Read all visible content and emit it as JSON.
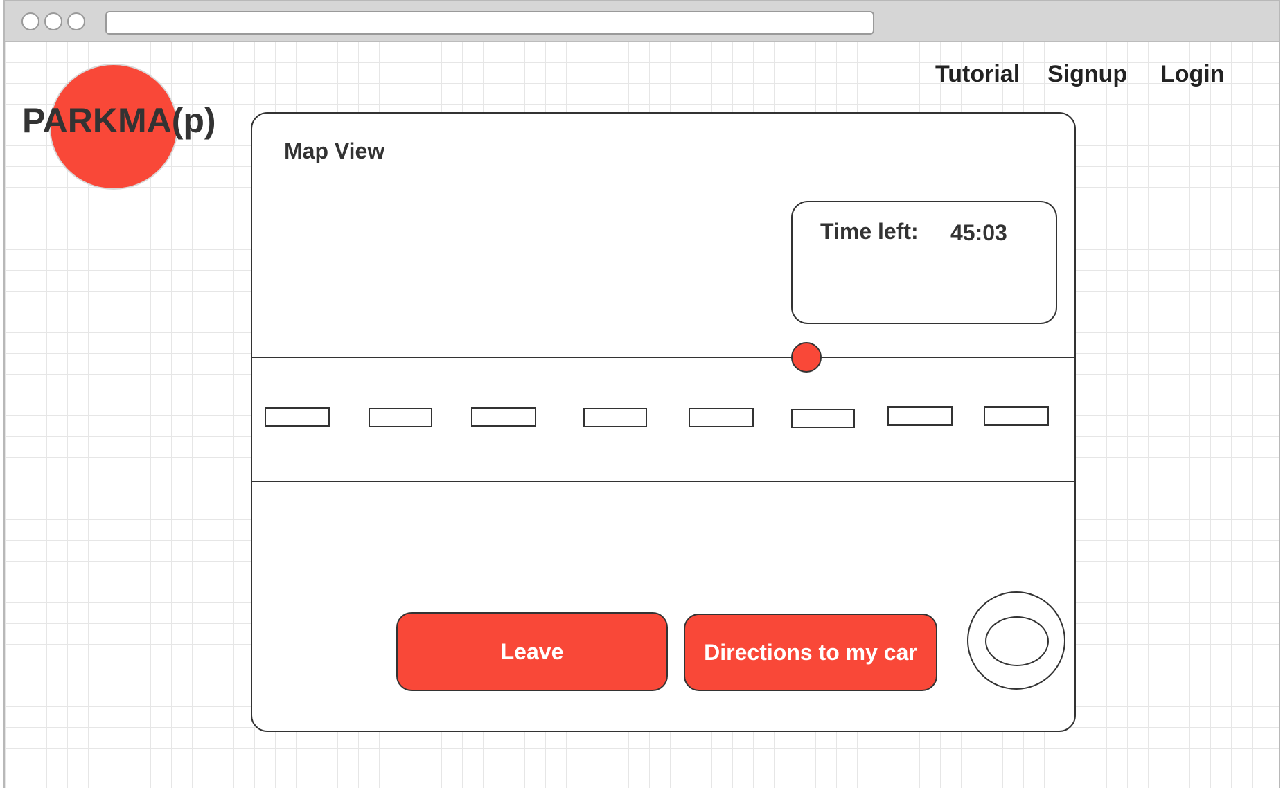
{
  "logo": {
    "text": "PARKMA(p)",
    "accent_color": "#f94838"
  },
  "nav": {
    "items": [
      {
        "label": "Tutorial"
      },
      {
        "label": "Signup"
      },
      {
        "label": "Login"
      }
    ]
  },
  "map": {
    "title": "Map View",
    "timer": {
      "label": "Time left:",
      "value": "45:03"
    },
    "parking_slot_count": 8
  },
  "actions": {
    "leave_label": "Leave",
    "directions_label": "Directions to my car"
  },
  "icons": {
    "window_controls": [
      "window-dot-icon",
      "window-dot-icon",
      "window-dot-icon"
    ],
    "car_marker": "location-marker-icon",
    "locate": "locate-button-icon"
  },
  "colors": {
    "accent": "#f94838",
    "outline": "#333333",
    "grid": "#e6e6e6"
  }
}
